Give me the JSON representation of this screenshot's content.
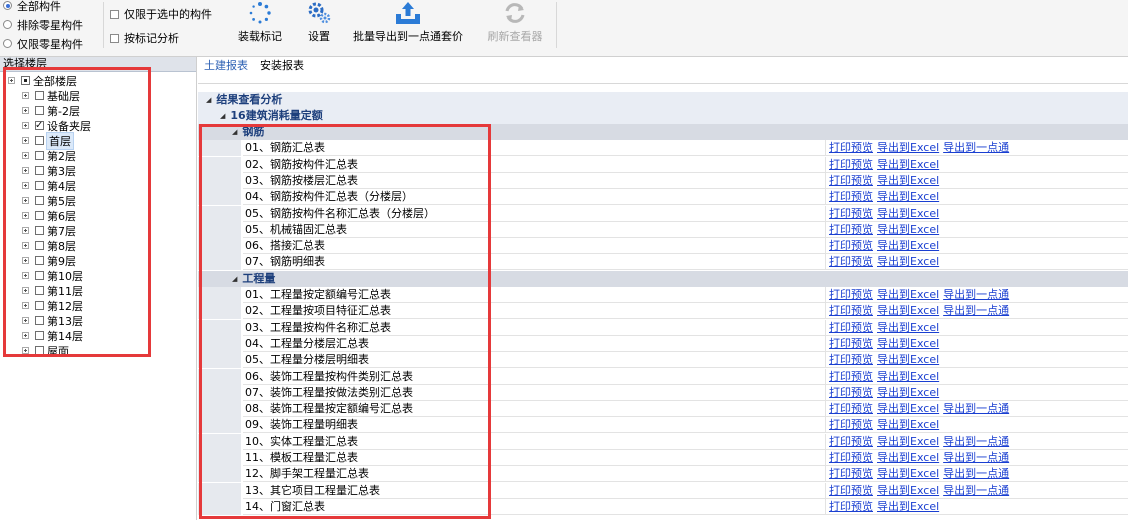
{
  "toolbar": {
    "radios": [
      {
        "label": "全部构件",
        "selected": true
      },
      {
        "label": "排除零星构件",
        "selected": false
      },
      {
        "label": "仅限零星构件",
        "selected": false
      }
    ],
    "checks": [
      {
        "label": "仅限于选中的构件",
        "checked": false
      },
      {
        "label": "按标记分析",
        "checked": false
      }
    ],
    "buttons": {
      "load_marks": "装载标记",
      "settings": "设置",
      "batch_export": "批量导出到一点通套价",
      "refresh_viewer": "刷新查看器"
    },
    "colors": {
      "icon_blue": "#2b7bd6",
      "disabled_gray": "#a8a8a8"
    }
  },
  "left": {
    "header": "选择楼层",
    "tree": [
      {
        "label": "全部楼层",
        "state": "partial",
        "level": 0
      },
      {
        "label": "基础层",
        "state": "unchecked",
        "level": 1
      },
      {
        "label": "第-2层",
        "state": "unchecked",
        "level": 1
      },
      {
        "label": "设备夹层",
        "state": "checked",
        "level": 1
      },
      {
        "label": "首层",
        "state": "unchecked",
        "level": 1,
        "selected": true
      },
      {
        "label": "第2层",
        "state": "unchecked",
        "level": 1
      },
      {
        "label": "第3层",
        "state": "unchecked",
        "level": 1
      },
      {
        "label": "第4层",
        "state": "unchecked",
        "level": 1
      },
      {
        "label": "第5层",
        "state": "unchecked",
        "level": 1
      },
      {
        "label": "第6层",
        "state": "unchecked",
        "level": 1
      },
      {
        "label": "第7层",
        "state": "unchecked",
        "level": 1
      },
      {
        "label": "第8层",
        "state": "unchecked",
        "level": 1
      },
      {
        "label": "第9层",
        "state": "unchecked",
        "level": 1
      },
      {
        "label": "第10层",
        "state": "unchecked",
        "level": 1
      },
      {
        "label": "第11层",
        "state": "unchecked",
        "level": 1
      },
      {
        "label": "第12层",
        "state": "unchecked",
        "level": 1
      },
      {
        "label": "第13层",
        "state": "unchecked",
        "level": 1
      },
      {
        "label": "第14层",
        "state": "unchecked",
        "level": 1
      },
      {
        "label": "屋面",
        "state": "unchecked",
        "level": 1
      }
    ]
  },
  "main": {
    "tabs": [
      {
        "label": "土建报表",
        "active": true
      },
      {
        "label": "安装报表",
        "active": false
      }
    ],
    "root": "结果查看分析",
    "group": "16建筑消耗量定额",
    "sections": [
      {
        "title": "钢筋",
        "rows": [
          {
            "name": "01、钢筋汇总表",
            "actions": [
              "打印预览",
              "导出到Excel",
              "导出到一点通"
            ]
          },
          {
            "name": "02、钢筋按构件汇总表",
            "actions": [
              "打印预览",
              "导出到Excel"
            ]
          },
          {
            "name": "03、钢筋按楼层汇总表",
            "actions": [
              "打印预览",
              "导出到Excel"
            ]
          },
          {
            "name": "04、钢筋按构件汇总表（分楼层）",
            "actions": [
              "打印预览",
              "导出到Excel"
            ]
          },
          {
            "name": "05、钢筋按构件名称汇总表（分楼层）",
            "actions": [
              "打印预览",
              "导出到Excel"
            ]
          },
          {
            "name": "05、机械锚固汇总表",
            "actions": [
              "打印预览",
              "导出到Excel"
            ]
          },
          {
            "name": "06、搭接汇总表",
            "actions": [
              "打印预览",
              "导出到Excel"
            ]
          },
          {
            "name": "07、钢筋明细表",
            "actions": [
              "打印预览",
              "导出到Excel"
            ]
          }
        ]
      },
      {
        "title": "工程量",
        "rows": [
          {
            "name": "01、工程量按定额编号汇总表",
            "actions": [
              "打印预览",
              "导出到Excel",
              "导出到一点通"
            ]
          },
          {
            "name": "02、工程量按项目特征汇总表",
            "actions": [
              "打印预览",
              "导出到Excel",
              "导出到一点通"
            ]
          },
          {
            "name": "03、工程量按构件名称汇总表",
            "actions": [
              "打印预览",
              "导出到Excel"
            ]
          },
          {
            "name": "04、工程量分楼层汇总表",
            "actions": [
              "打印预览",
              "导出到Excel"
            ]
          },
          {
            "name": "05、工程量分楼层明细表",
            "actions": [
              "打印预览",
              "导出到Excel"
            ]
          },
          {
            "name": "06、装饰工程量按构件类别汇总表",
            "actions": [
              "打印预览",
              "导出到Excel"
            ]
          },
          {
            "name": "07、装饰工程量按做法类别汇总表",
            "actions": [
              "打印预览",
              "导出到Excel"
            ]
          },
          {
            "name": "08、装饰工程量按定额编号汇总表",
            "actions": [
              "打印预览",
              "导出到Excel",
              "导出到一点通"
            ]
          },
          {
            "name": "09、装饰工程量明细表",
            "actions": [
              "打印预览",
              "导出到Excel"
            ]
          },
          {
            "name": "10、实体工程量汇总表",
            "actions": [
              "打印预览",
              "导出到Excel",
              "导出到一点通"
            ]
          },
          {
            "name": "11、模板工程量汇总表",
            "actions": [
              "打印预览",
              "导出到Excel",
              "导出到一点通"
            ]
          },
          {
            "name": "12、脚手架工程量汇总表",
            "actions": [
              "打印预览",
              "导出到Excel",
              "导出到一点通"
            ]
          },
          {
            "name": "13、其它项目工程量汇总表",
            "actions": [
              "打印预览",
              "导出到Excel",
              "导出到一点通"
            ]
          },
          {
            "name": "14、门窗汇总表",
            "actions": [
              "打印预览",
              "导出到Excel"
            ]
          }
        ]
      }
    ],
    "highlight_color": "#e5393a"
  }
}
